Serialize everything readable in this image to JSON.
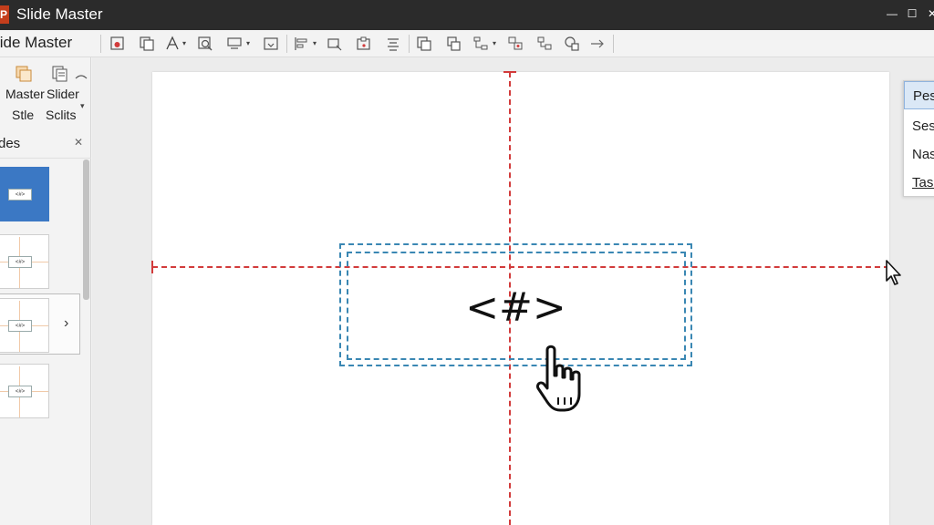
{
  "window": {
    "app_icon_letter": "P",
    "title": "Slide Master",
    "controls": {
      "minimize": "—",
      "maximize": "☐",
      "close": "✕"
    }
  },
  "ribbon": {
    "tab_label": "lide Master",
    "tools": [
      "insert-slide-master-icon",
      "insert-layout-icon",
      "font-icon",
      "zoom-icon",
      "placeholder-icon",
      "rename-icon",
      "align-icon",
      "crop-icon",
      "preserve-icon",
      "center-icon",
      "copy-icon",
      "duplicate-icon",
      "layout-icon",
      "group-icon",
      "arrange-icon",
      "shape-icon",
      "arrow-icon"
    ]
  },
  "left_panel": {
    "master_label": "Master",
    "master_sublabel": "Stle",
    "slider_label": "Slider",
    "slider_sublabel": "Sclits",
    "pane_title": "des",
    "pane_close": "✕",
    "expand_arrow": "›",
    "thumbnails": [
      {
        "placeholder": "<#>",
        "selected": true
      },
      {
        "placeholder": "<#>",
        "selected": false
      },
      {
        "placeholder": "<#>",
        "selected": false
      },
      {
        "placeholder": "<#>",
        "selected": false
      }
    ]
  },
  "slide": {
    "placeholder_text": "<#>"
  },
  "right_pane": {
    "items": [
      {
        "label": "Pes",
        "active": true
      },
      {
        "label": "Ses",
        "active": false
      },
      {
        "label": "Nas",
        "active": false
      },
      {
        "label": "Tasl",
        "active": false
      }
    ]
  },
  "colors": {
    "guide": "#d23b3b",
    "placeholder_border": "#3a87b3",
    "thumb_selected": "#3b78c4",
    "titlebar": "#2b2b2b"
  }
}
